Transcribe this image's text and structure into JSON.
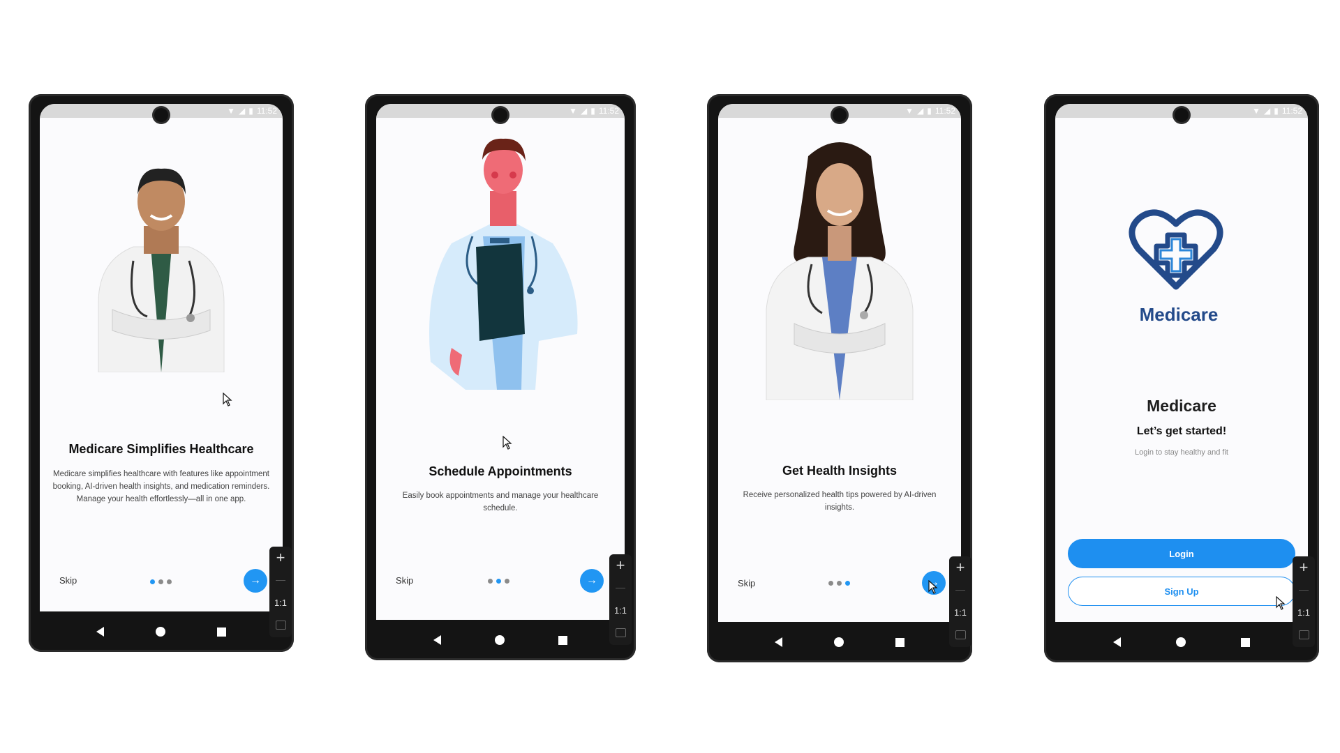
{
  "status_time": "11:52",
  "sidebar": {
    "zoom_in": "+",
    "actual_size": "1:1"
  },
  "screens": [
    {
      "hero": "man-doctor-photo",
      "title": "Medicare Simplifies Healthcare",
      "description": "Medicare simplifies healthcare with features like appointment booking, AI-driven health insights, and medication reminders. Manage your health effortlessly—all in one app.",
      "skip": "Skip",
      "active_dot": 1
    },
    {
      "hero": "doctor-illustration",
      "title": "Schedule Appointments",
      "description": "Easily book appointments and manage your healthcare schedule.",
      "skip": "Skip",
      "active_dot": 2
    },
    {
      "hero": "woman-doctor-photo",
      "title": "Get Health Insights",
      "description": "Receive personalized health tips powered by AI-driven insights.",
      "skip": "Skip",
      "active_dot": 3
    },
    {
      "logo_text": "Medicare",
      "app_title": "Medicare",
      "tagline": "Let’s get started!",
      "subtext": "Login to stay healthy and fit",
      "login": "Login",
      "signup": "Sign Up"
    }
  ],
  "colors": {
    "accent": "#2196f3",
    "logo": "#234a8a"
  }
}
